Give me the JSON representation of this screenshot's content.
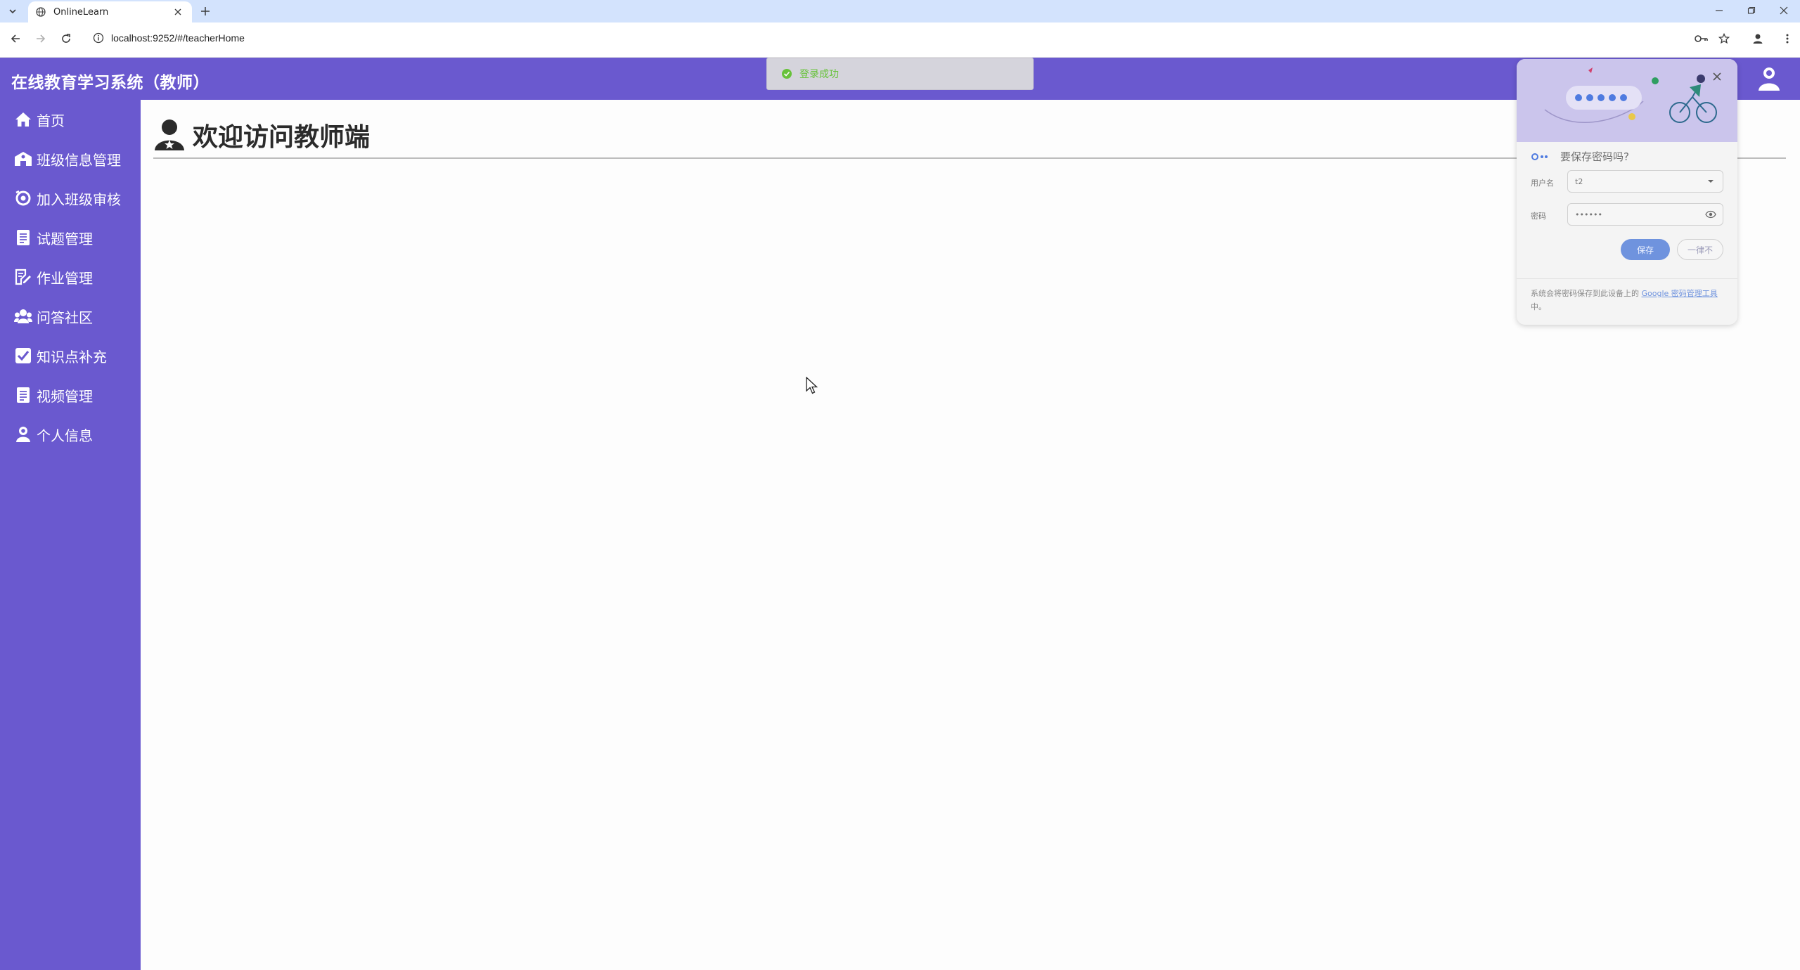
{
  "browser": {
    "tab_title": "OnlineLearn",
    "url": "localhost:9252/#/teacherHome"
  },
  "header": {
    "title": "在线教育学习系统（教师）"
  },
  "sidebar": {
    "items": [
      {
        "label": "首页",
        "icon": "home-icon"
      },
      {
        "label": "班级信息管理",
        "icon": "school-icon"
      },
      {
        "label": "加入班级审核",
        "icon": "review-icon"
      },
      {
        "label": "试题管理",
        "icon": "document-icon"
      },
      {
        "label": "作业管理",
        "icon": "edit-document-icon"
      },
      {
        "label": "问答社区",
        "icon": "users-icon"
      },
      {
        "label": "知识点补充",
        "icon": "checkbox-icon"
      },
      {
        "label": "视频管理",
        "icon": "document-icon"
      },
      {
        "label": "个人信息",
        "icon": "user-icon"
      }
    ]
  },
  "main": {
    "heading": "欢迎访问教师端"
  },
  "toast": {
    "message": "登录成功"
  },
  "password_bubble": {
    "title": "要保存密码吗?",
    "username_label": "用户名",
    "username_value": "t2",
    "password_label": "密码",
    "password_value": "••••••",
    "save_label": "保存",
    "never_label": "一律不",
    "footer_text": "系统会将密码保存到此设备上的 ",
    "footer_link": "Google 密码管理工具",
    "footer_suffix": "中。"
  },
  "colors": {
    "brand_purple": "#6a59cf",
    "toast_success": "#67c23a",
    "google_blue": "#6f93de"
  }
}
